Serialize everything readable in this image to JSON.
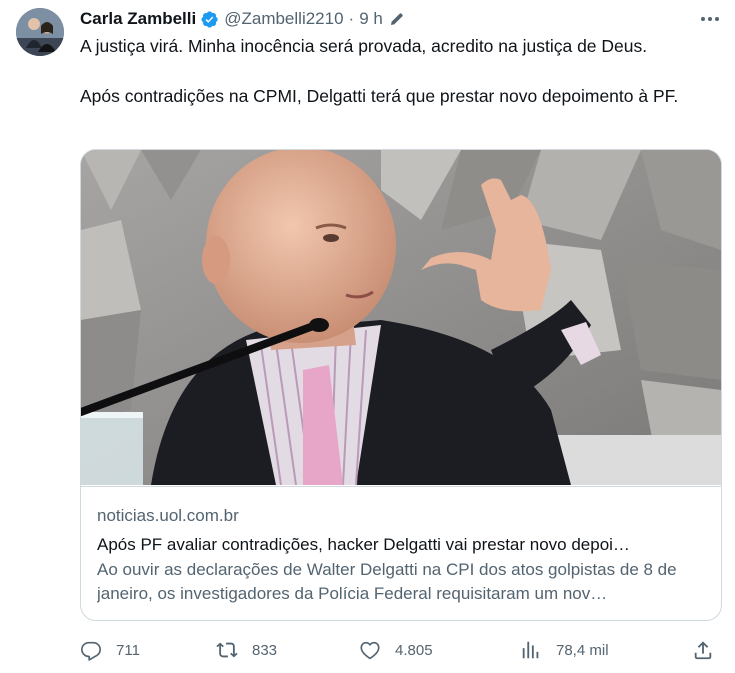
{
  "author": {
    "name": "Carla Zambelli",
    "handle": "@Zambelli2210",
    "separator": "·",
    "time": "9 h",
    "verified": true,
    "avatar_icon": "profile-photo"
  },
  "tweet": {
    "paragraphs": [
      "A justiça virá. Minha inocência será provada, acredito na justiça de Deus.",
      "Após contradições na CPMI, Delgatti terá que prestar novo depoimento à PF."
    ]
  },
  "link_card": {
    "image_description_icon": "man-speaking-at-microphone-photo",
    "domain": "noticias.uol.com.br",
    "title": "Após PF avaliar contradições, hacker Delgatti vai prestar novo depoi…",
    "description": "Ao ouvir as declarações de Walter Delgatti na CPI dos atos golpistas de 8 de janeiro, os investigadores da Polícia Federal requisitaram um nov…"
  },
  "actions": {
    "replies": "711",
    "retweets": "833",
    "likes": "4.805",
    "views": "78,4 mil"
  },
  "colors": {
    "text": "#0f1419",
    "secondary": "#536471",
    "border": "#cfd9de",
    "verified": "#1d9bf0"
  }
}
